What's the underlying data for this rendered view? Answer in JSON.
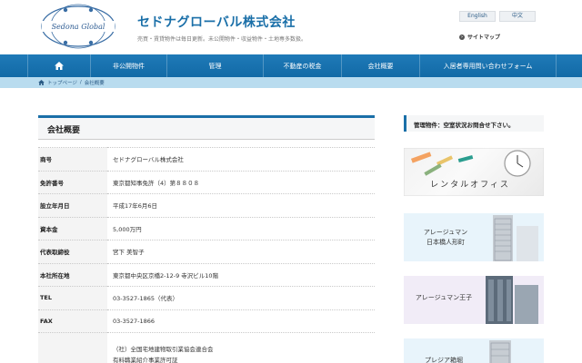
{
  "header": {
    "logo_text": "Sedona Global",
    "brand": "セドナグローバル株式会社",
    "tagline": "売買・賃貸物件は毎日更新。未公開物件・収益物件・土地専多数扱。",
    "lang_en": "English",
    "lang_zh": "中文",
    "sitemap": "サイトマップ"
  },
  "nav": {
    "items": [
      "非公開物件",
      "管理",
      "不動産の税金",
      "会社概要",
      "入居者専用問い合わせフォーム"
    ]
  },
  "breadcrumb": {
    "home": "トップページ",
    "sep": "/",
    "current": "会社概要"
  },
  "main": {
    "title": "会社概要",
    "rows": [
      {
        "label": "商号",
        "value": "セドナグローバル株式会社"
      },
      {
        "label": "免許番号",
        "value": "東京都知事免許（4）第８８０８"
      },
      {
        "label": "設立年月日",
        "value": "平成17年6月6日"
      },
      {
        "label": "資本金",
        "value": "5,000万円"
      },
      {
        "label": "代表取締役",
        "value": "宮下 美智子"
      },
      {
        "label": "本社所在地",
        "value": "東京都中央区京橋2-12-9 寺沢ビル10階"
      },
      {
        "label": "TEL",
        "value": "03-3527-1865（代表）"
      },
      {
        "label": "FAX",
        "value": "03-3527-1866"
      }
    ],
    "memberships": [
      "（社）全国宅地建物取引業協会連合会",
      "有料職業紹介事業許可証"
    ]
  },
  "sidebar": {
    "heading": "管理物件：空室状況お問合せ下さい。",
    "banners": [
      "レンタルオフィス",
      "アレージュマン",
      "日本橋人形町",
      "アレージュマン王子",
      "プレジア箱堀"
    ]
  },
  "colors": {
    "accent": "#1a6fa8",
    "nav": "#1a72b0",
    "breadcrumb": "#b9dcef"
  }
}
